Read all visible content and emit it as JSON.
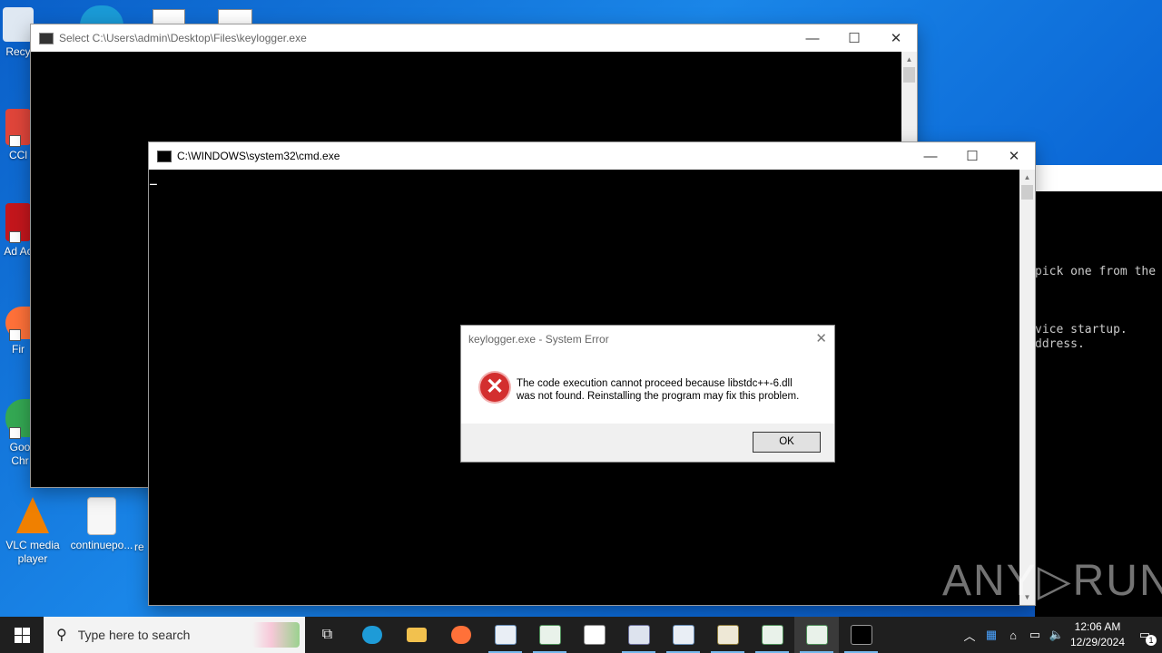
{
  "desktop": {
    "icons": [
      {
        "label": "Recy"
      },
      {
        "label": "CCl"
      },
      {
        "label": "Ad Acr"
      },
      {
        "label": "Fir"
      },
      {
        "label": "Goo Chr"
      },
      {
        "label": "VLC media player"
      },
      {
        "label": "continuepo..."
      },
      {
        "label": "re"
      }
    ]
  },
  "back_window": {
    "title": "Select C:\\Users\\admin\\Desktop\\Files\\keylogger.exe"
  },
  "cmd_window": {
    "title": "C:\\WINDOWS\\system32\\cmd.exe",
    "cursor": "_"
  },
  "right_console": {
    "lines": [
      "pick one from the",
      "",
      "",
      "",
      "vice startup.",
      "ddress."
    ]
  },
  "dialog": {
    "title": "keylogger.exe - System Error",
    "message_line1": "The code execution cannot proceed because libstdc++-6.dll",
    "message_line2": "was not found. Reinstalling the program may fix this problem.",
    "ok_label": "OK",
    "icon": "error-icon"
  },
  "window_buttons": {
    "minimize": "—",
    "maximize": "☐",
    "close": "✕"
  },
  "watermark": "ANY▷RUN",
  "taskbar": {
    "search_placeholder": "Type here to search",
    "apps": [
      "task-view",
      "edge",
      "file-explorer",
      "firefox",
      "app1",
      "app2",
      "app3",
      "app4",
      "app5",
      "app6",
      "app7",
      "app8",
      "cmd"
    ],
    "clock_time": "12:06 AM",
    "clock_date": "12/29/2024",
    "notification_count": "1"
  },
  "colors": {
    "desktop": "#0b68d6",
    "console": "#000000",
    "error_red": "#d32f2f",
    "taskbar": "#1f1f1f"
  }
}
